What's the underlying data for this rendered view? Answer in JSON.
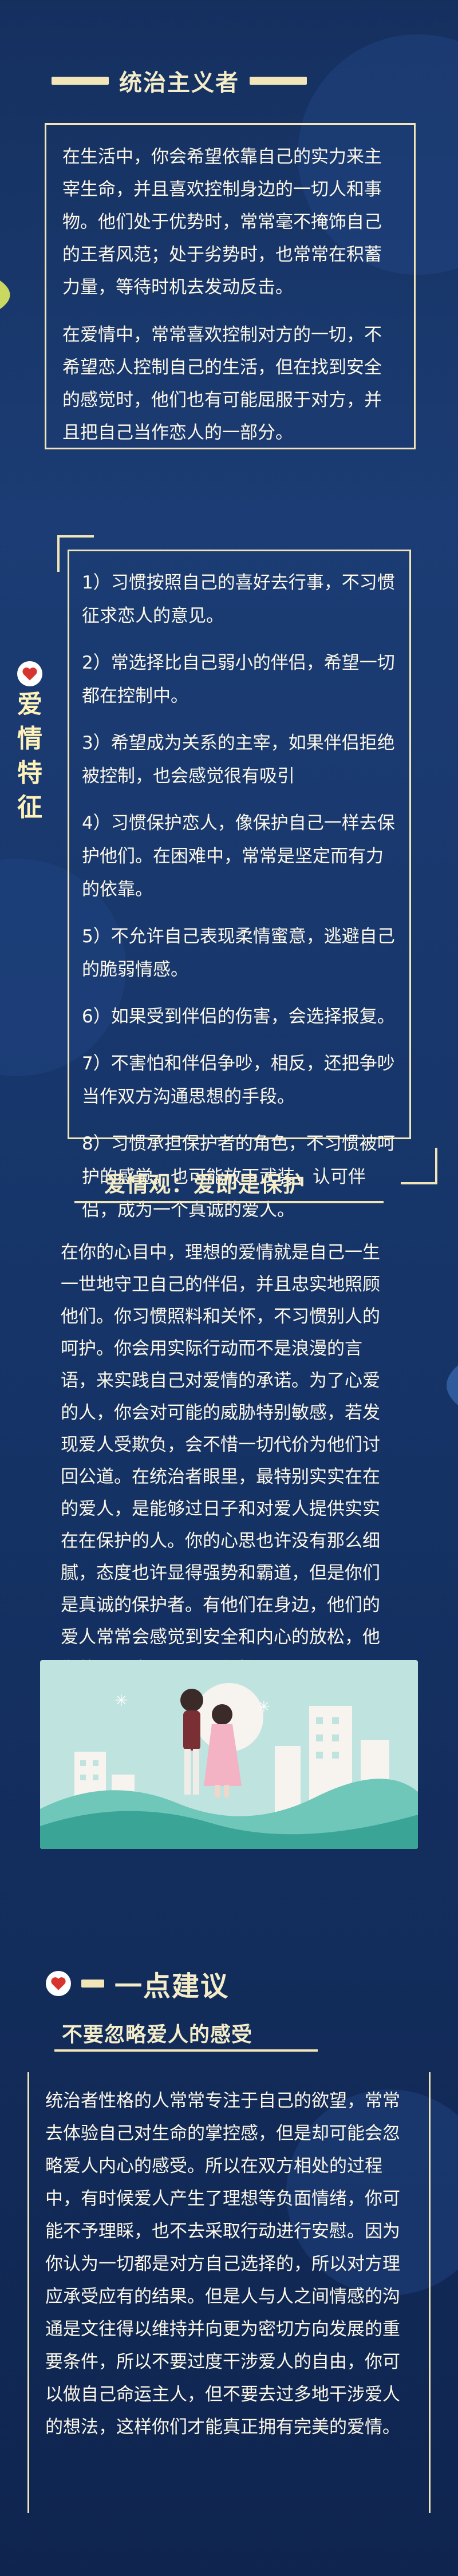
{
  "section1": {
    "title": "统治主义者",
    "paragraphs": [
      "在生活中，你会希望依靠自己的实力来主宰生命，并且喜欢控制身边的一切人和事物。他们处于优势时，常常毫不掩饰自己的王者风范；处于劣势时，也常常在积蓄力量，等待时机去发动反击。",
      "在爱情中，常常喜欢控制对方的一切，不希望恋人控制自己的生活，但在找到安全的感觉时，他们也有可能屈服于对方，并且把自己当作恋人的一部分。"
    ]
  },
  "section2": {
    "side_label": [
      "爱",
      "情",
      "特",
      "征"
    ],
    "items": [
      "1）习惯按照自己的喜好去行事，不习惯征求恋人的意见。",
      "2）常选择比自己弱小的伴侣，希望一切都在控制中。",
      "3）希望成为关系的主宰，如果伴侣拒绝被控制，也会感觉很有吸引",
      "4）习惯保护恋人，像保护自己一样去保护他们。在困难中，常常是坚定而有力的依靠。",
      "5）不允许自己表现柔情蜜意，逃避自己的脆弱情感。",
      "6）如果受到伴侣的伤害，会选择报复。",
      "7）不害怕和伴侣争吵，相反，还把争吵当作双方沟通思想的手段。",
      "8）习惯承担保护者的角色，不习惯被呵护的感觉。也可能放下武装，认可伴侣，成为一个真诚的爱人。"
    ]
  },
  "section3": {
    "subtitle": "爱情观：爱即是保护",
    "paragraph": "在你的心目中，理想的爱情就是自己一生一世地守卫自己的伴侣，并且忠实地照顾他们。你习惯照料和关怀，不习惯别人的呵护。你会用实际行动而不是浪漫的言语，来实践自己对爱情的承诺。为了心爱的人，你会对可能的威胁特别敏感，若发现爱人受欺负，会不惜一切代价为他们讨回公道。在统治者眼里，最特别实实在在的爱人，是能够过日子和对爱人提供实实在在保护的人。你的心思也许没有那么细腻，态度也许显得强势和霸道，但是你们是真诚的保护者。有他们在身边，他们的爱人常常会感觉到安全和内心的放松，他们的心目中，爱即是保护。"
  },
  "section4": {
    "title": "一点建议",
    "subtitle": "不要忽略爱人的感受",
    "paragraph": "统治者性格的人常常专注于自己的欲望，常常去体验自己对生命的掌控感，但是却可能会忽略爱人内心的感受。所以在双方相处的过程中，有时候爱人产生了理想等负面情绪，你可能不予理睬，也不去采取行动进行安慰。因为你认为一切都是对方自己选择的，所以对方理应承受应有的结果。但是人与人之间情感的沟通是文往得以维持并向更为密切方向发展的重要条件，所以不要过度干涉爱人的自由，你可以做自己命运主人，但不要去过多地干涉爱人的想法，这样你们才能真正拥有完美的爱情。"
  },
  "colors": {
    "background": "#15305f",
    "accent": "#f2e6b8",
    "text": "#fdf8e9",
    "heart": "#d8342f"
  },
  "icons": [
    "heart-icon",
    "star-icon",
    "leaf-icon",
    "couple-illustration"
  ]
}
